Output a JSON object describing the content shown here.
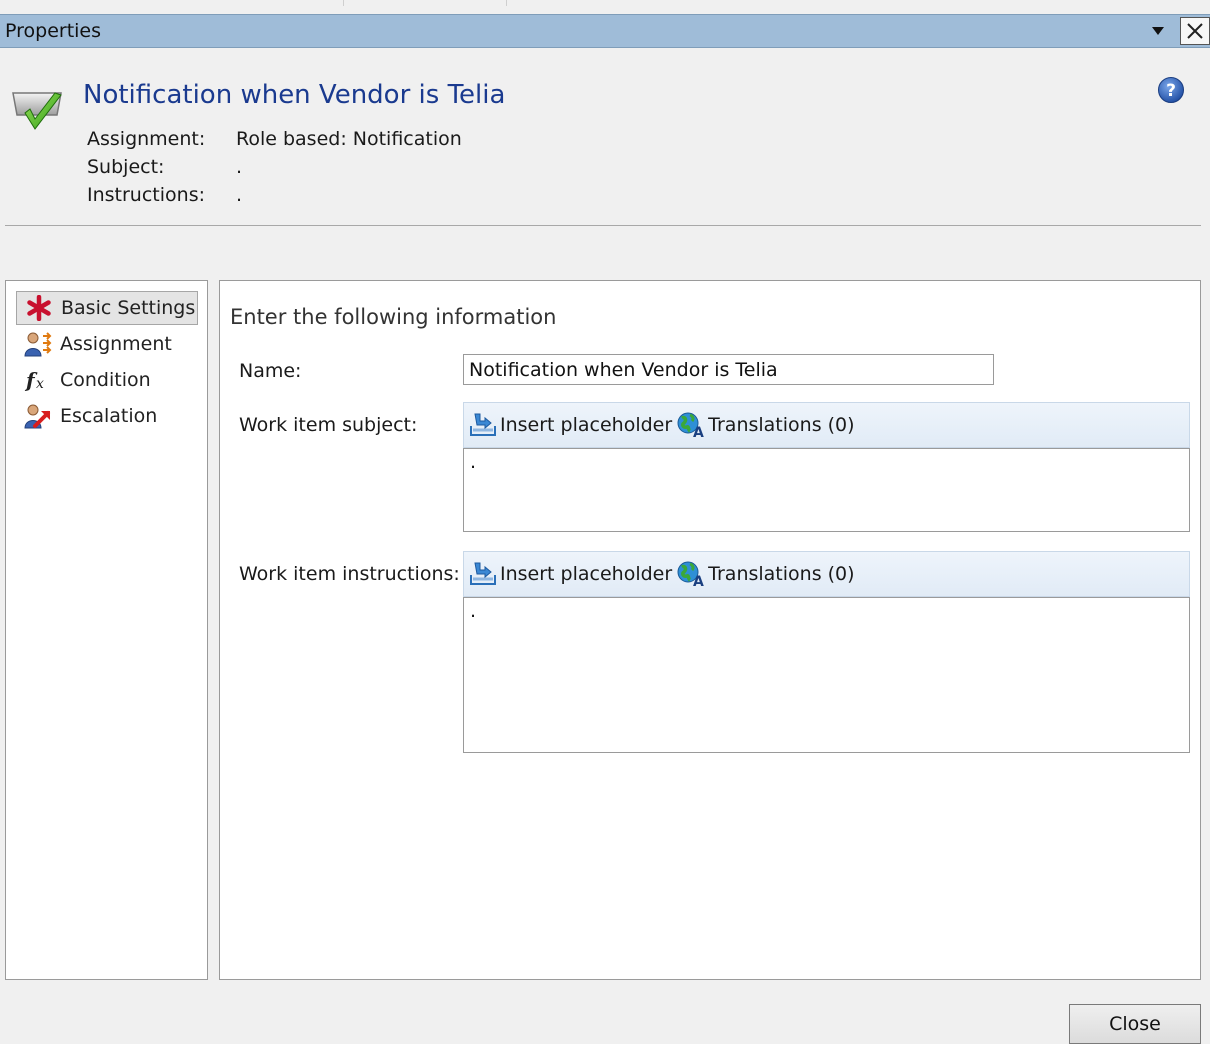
{
  "window": {
    "title": "Properties"
  },
  "header": {
    "title": "Notification when Vendor is Telia",
    "fields": [
      {
        "label": "Assignment:",
        "value": "Role based: Notification"
      },
      {
        "label": "Subject:",
        "value": "."
      },
      {
        "label": "Instructions:",
        "value": "."
      }
    ]
  },
  "nav": {
    "items": [
      {
        "label": "Basic Settings",
        "icon": "asterisk-icon",
        "selected": true
      },
      {
        "label": "Assignment",
        "icon": "user-assignment-icon"
      },
      {
        "label": "Condition",
        "icon": "fx-function-icon"
      },
      {
        "label": "Escalation",
        "icon": "user-escalation-icon"
      }
    ]
  },
  "main": {
    "heading": "Enter the following information",
    "name": {
      "label": "Name:",
      "value": "Notification when Vendor is Telia"
    },
    "subject": {
      "label": "Work item subject:",
      "insert_label": "Insert placeholder",
      "translations_label": "Translations (0)",
      "value": "."
    },
    "instructions": {
      "label": "Work item instructions:",
      "insert_label": "Insert placeholder",
      "translations_label": "Translations (0)",
      "value": "."
    }
  },
  "footer": {
    "close_label": "Close"
  },
  "colors": {
    "title_bar": "#9fbcd8",
    "header_title": "#1a3a8f",
    "accent_red": "#c8102e"
  }
}
